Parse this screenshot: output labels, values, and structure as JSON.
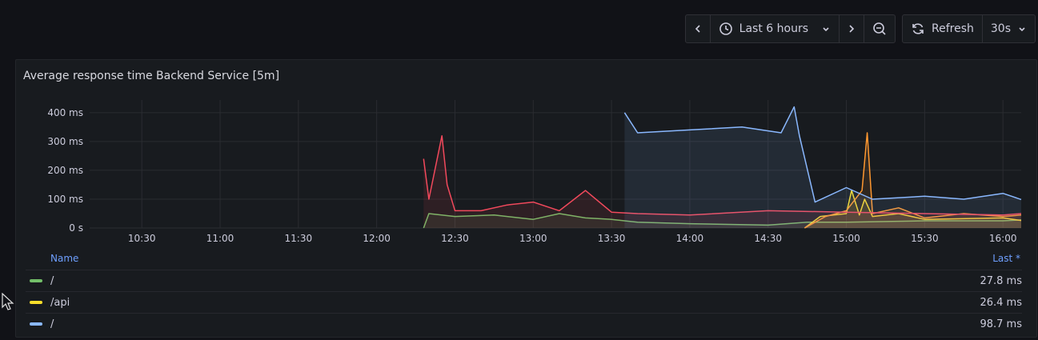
{
  "toolbar": {
    "time_range": "Last 6 hours",
    "refresh_label": "Refresh",
    "refresh_interval": "30s",
    "icons": [
      "chevron-left-icon",
      "clock-icon",
      "chevron-down-icon",
      "chevron-right-icon",
      "zoom-out-icon",
      "refresh-icon",
      "chevron-down-icon"
    ]
  },
  "panel": {
    "title": "Average response time Backend Service [5m]"
  },
  "legend": {
    "name_header": "Name",
    "last_header": "Last *",
    "items": [
      {
        "name": "/",
        "last": "27.8 ms",
        "color": "#73bf69"
      },
      {
        "name": "/api",
        "last": "26.4 ms",
        "color": "#fade2a"
      },
      {
        "name": "/",
        "last": "98.7 ms",
        "color": "#8ab8ff"
      }
    ]
  },
  "chart_data": {
    "type": "line",
    "title": "Average response time Backend Service [5m]",
    "x_tick_labels": [
      "10:30",
      "11:00",
      "11:30",
      "12:00",
      "12:30",
      "13:00",
      "13:30",
      "14:00",
      "14:30",
      "15:00",
      "15:30",
      "16:00"
    ],
    "y_tick_labels": [
      "0 s",
      "100 ms",
      "200 ms",
      "300 ms",
      "400 ms"
    ],
    "x_range": [
      "10:10",
      "16:07"
    ],
    "ylim": [
      0,
      430
    ],
    "grid": true,
    "legend_placement": "bottom",
    "series": [
      {
        "color": "#73bf69",
        "x": [
          "12:18",
          "12:20",
          "12:30",
          "12:45",
          "13:00",
          "13:10",
          "13:20",
          "13:30",
          "13:40",
          "14:00",
          "14:30",
          "14:45",
          "15:00",
          "15:30",
          "16:00",
          "16:07"
        ],
        "y": [
          0,
          50,
          40,
          45,
          30,
          50,
          35,
          30,
          20,
          15,
          10,
          20,
          20,
          25,
          25,
          28
        ]
      },
      {
        "color": "#fade2a",
        "x": [
          "14:44",
          "14:50",
          "15:00",
          "15:02",
          "15:05",
          "15:07",
          "15:10",
          "15:20",
          "15:30",
          "16:00",
          "16:07"
        ],
        "y": [
          0,
          40,
          50,
          130,
          45,
          100,
          40,
          50,
          30,
          35,
          26
        ]
      },
      {
        "color": "#ff9830",
        "x": [
          "14:44",
          "14:52",
          "15:00",
          "15:06",
          "15:08",
          "15:10",
          "15:20",
          "15:30",
          "15:45",
          "16:00",
          "16:07"
        ],
        "y": [
          0,
          40,
          60,
          130,
          330,
          50,
          70,
          35,
          50,
          40,
          45
        ]
      },
      {
        "color": "#f2495c",
        "x": [
          "12:18",
          "12:20",
          "12:25",
          "12:27",
          "12:30",
          "12:40",
          "12:50",
          "13:00",
          "13:10",
          "13:20",
          "13:30",
          "13:40",
          "14:00",
          "14:30",
          "15:00",
          "15:30",
          "16:00",
          "16:07"
        ],
        "y": [
          240,
          100,
          320,
          150,
          60,
          60,
          80,
          90,
          60,
          130,
          55,
          50,
          45,
          60,
          55,
          50,
          45,
          50
        ]
      },
      {
        "color": "#8ab8ff",
        "x": [
          "13:35",
          "13:40",
          "14:00",
          "14:20",
          "14:35",
          "14:40",
          "14:42",
          "14:48",
          "15:00",
          "15:10",
          "15:30",
          "15:45",
          "16:00",
          "16:07"
        ],
        "y": [
          400,
          330,
          340,
          350,
          330,
          420,
          320,
          90,
          140,
          100,
          110,
          100,
          120,
          98.7
        ]
      }
    ]
  }
}
